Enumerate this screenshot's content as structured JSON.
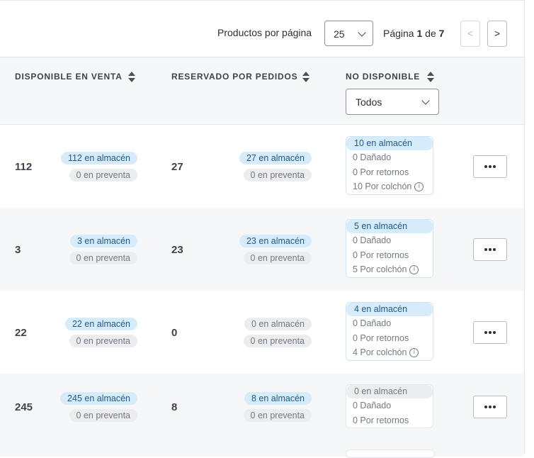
{
  "pagination": {
    "per_page_label": "Productos por página",
    "per_page_value": "25",
    "page_prefix": "Página",
    "page_current": "1",
    "page_of": "de",
    "page_total": "7",
    "prev_label": "<",
    "next_label": ">"
  },
  "columns": {
    "available": "DISPONIBLE EN VENTA",
    "reserved": "RESERVADO POR PEDIDOS",
    "unavailable": "NO DISPONIBLE",
    "unavailable_filter": "Todos"
  },
  "rows": [
    {
      "available_total": "112",
      "available_stock": "112 en almacén",
      "available_presale": "0 en preventa",
      "reserved_total": "27",
      "reserved_stock": "27 en almacén",
      "reserved_presale": "0 en preventa",
      "nd_stock": "10 en almacén",
      "nd_damaged": "0 Dañado",
      "nd_returns": "0 Por retornos",
      "nd_cushion": "10 Por colchón"
    },
    {
      "available_total": "3",
      "available_stock": "3 en almacén",
      "available_presale": "0 en preventa",
      "reserved_total": "23",
      "reserved_stock": "23 en almacén",
      "reserved_presale": "0 en preventa",
      "nd_stock": "5 en almacén",
      "nd_damaged": "0 Dañado",
      "nd_returns": "0 Por retornos",
      "nd_cushion": "5 Por colchón"
    },
    {
      "available_total": "22",
      "available_stock": "22 en almacén",
      "available_presale": "0 en preventa",
      "reserved_total": "0",
      "reserved_stock": "0 en almacén",
      "reserved_presale": "0 en preventa",
      "nd_stock": "4 en almacén",
      "nd_damaged": "0 Dañado",
      "nd_returns": "0 Por retornos",
      "nd_cushion": "4 Por colchón"
    },
    {
      "available_total": "245",
      "available_stock": "245 en almacén",
      "available_presale": "0 en preventa",
      "reserved_total": "8",
      "reserved_stock": "8 en almacén",
      "reserved_presale": "0 en preventa",
      "nd_stock": "0 en almacén",
      "nd_damaged": "0 Dañado",
      "nd_returns": "0 Por retornos"
    }
  ],
  "colors": {
    "badge_blue_bg": "#d6ecfb",
    "badge_blue_text": "#1f5a8a",
    "badge_gray_bg": "#ecedef",
    "row_alt_bg": "#f6f7f9"
  }
}
